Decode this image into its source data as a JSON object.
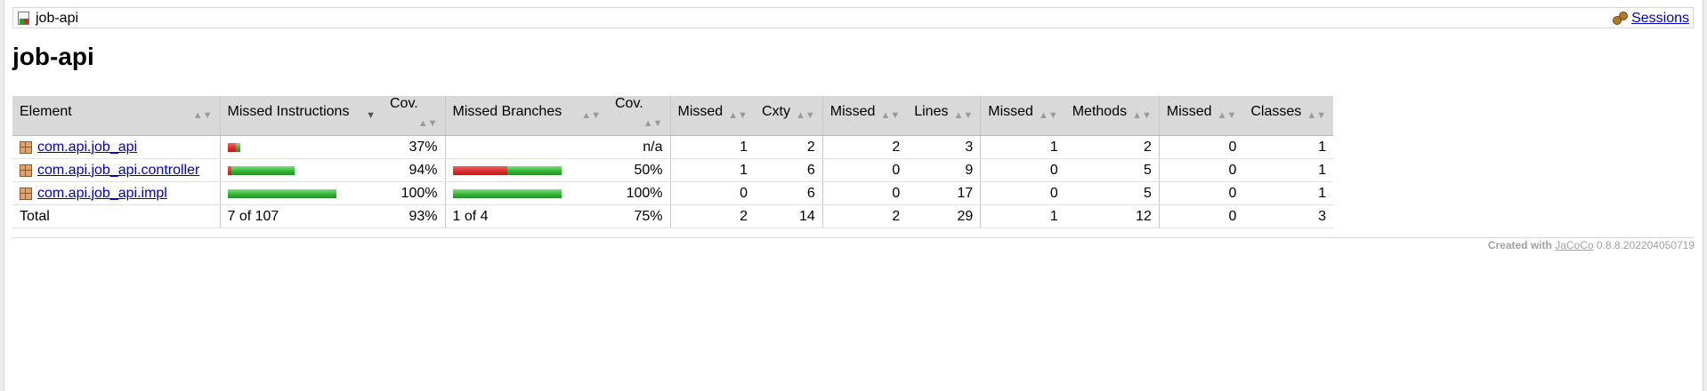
{
  "breadcrumb": {
    "current": "job-api",
    "sessions_label": "Sessions"
  },
  "title": "job-api",
  "table": {
    "headers": [
      "Element",
      "Missed Instructions",
      "Cov.",
      "Missed Branches",
      "Cov.",
      "Missed",
      "Cxty",
      "Missed",
      "Lines",
      "Missed",
      "Methods",
      "Missed",
      "Classes"
    ],
    "rows": [
      {
        "element": "com.api.job_api",
        "instr_missed_fraction": 0.63,
        "instr_cov": "37%",
        "branch_missed_fraction": null,
        "branch_cov": "n/a",
        "cxty_missed": "1",
        "cxty": "2",
        "lines_missed": "2",
        "lines": "3",
        "methods_missed": "1",
        "methods": "2",
        "classes_missed": "0",
        "classes": "1"
      },
      {
        "element": "com.api.job_api.controller",
        "instr_missed_fraction": 0.06,
        "instr_cov": "94%",
        "branch_missed_fraction": 0.5,
        "branch_cov": "50%",
        "cxty_missed": "1",
        "cxty": "6",
        "lines_missed": "0",
        "lines": "9",
        "methods_missed": "0",
        "methods": "5",
        "classes_missed": "0",
        "classes": "1"
      },
      {
        "element": "com.api.job_api.impl",
        "instr_missed_fraction": 0.0,
        "instr_cov": "100%",
        "branch_missed_fraction": 0.0,
        "branch_cov": "100%",
        "cxty_missed": "0",
        "cxty": "6",
        "lines_missed": "0",
        "lines": "17",
        "methods_missed": "0",
        "methods": "5",
        "classes_missed": "0",
        "classes": "1"
      }
    ],
    "total": {
      "label": "Total",
      "instr": "7 of 107",
      "instr_cov": "93%",
      "branch": "1 of 4",
      "branch_cov": "75%",
      "cxty_missed": "2",
      "cxty": "14",
      "lines_missed": "2",
      "lines": "29",
      "methods_missed": "1",
      "methods": "12",
      "classes_missed": "0",
      "classes": "3"
    }
  },
  "footer": {
    "prefix": "Created with",
    "link": "JaCoCo",
    "version": "0.8.8.202204050719"
  },
  "colors": {
    "missed": "#d62c2c",
    "covered": "#2fb22f",
    "link": "#0000cc",
    "header_bg": "#d9d9d9"
  },
  "icons": {
    "report": "report-icon",
    "sessions": "sessions-icon",
    "package": "package-icon"
  }
}
